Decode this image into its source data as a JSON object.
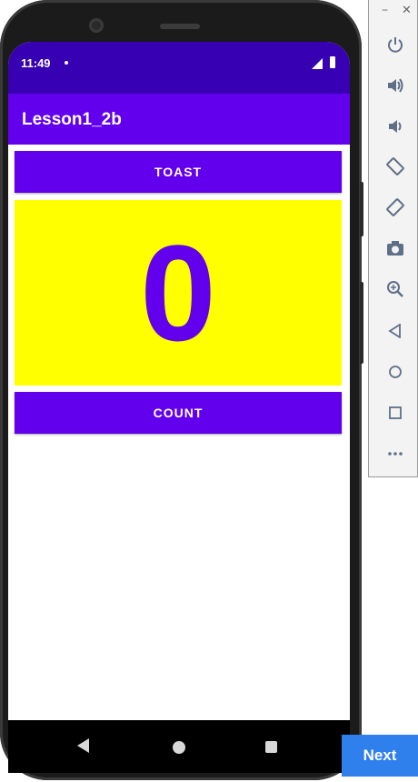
{
  "status_bar": {
    "time": "11:49"
  },
  "app_bar": {
    "title": "Lesson1_2b"
  },
  "toast_button": {
    "label": "TOAST"
  },
  "count": {
    "value": "0"
  },
  "count_button": {
    "label": "COUNT"
  },
  "emulator_toolbar": {
    "window_controls": [
      "minimize",
      "close"
    ],
    "tools": [
      "power-icon",
      "volume-up-icon",
      "volume-down-icon",
      "rotate-left-icon",
      "rotate-right-icon",
      "camera-icon",
      "zoom-icon",
      "back-icon",
      "home-icon",
      "overview-icon",
      "more-icon"
    ]
  },
  "wizard": {
    "next_label": "Next"
  },
  "colors": {
    "status_bar": "#3700b3",
    "app_bar": "#6200ee",
    "button": "#6200ee",
    "count_background": "#ffff00",
    "count_text": "#6200ee",
    "next_button": "#2f80ed"
  }
}
